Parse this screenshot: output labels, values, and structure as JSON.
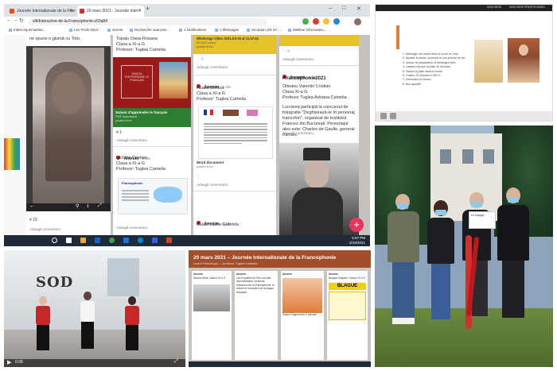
{
  "browser": {
    "tabs": [
      {
        "label": "Journée Internationale de la Fran"
      },
      {
        "label": "20 mars 2021 - Journée Inter"
      }
    ],
    "new_tab": "+",
    "window_controls": [
      "–",
      "□",
      "✕"
    ],
    "nav": [
      "←",
      "→",
      "↻"
    ],
    "url": "ellt/Interactive-de-la-Francophonie-z03a84"
  },
  "bookmarks": [
    "Interconjorimianito...",
    "Les Profs 2013",
    "semne",
    "Recherche avancée...",
    "1 Notifications",
    "1 Messages",
    "Scorpion (24.10 -...",
    "Meilleur Décoration..."
  ],
  "padlet": {
    "top_caption": "ne spune o glumă cu Toto.",
    "col2": {
      "top_lines": [
        "Topalu Oana-Roxana",
        "Clasa a XI-a G",
        "Profesor: Tuglea Camelia"
      ],
      "book_title": "SAISON D'APPRENDRE LE FRANÇAIS",
      "doc_title": "Saison d'apprendre le français",
      "doc_type": "PDF document",
      "doc_src": "padlet drive",
      "likes": "1",
      "comment": "Adaugă comentariu",
      "author": "Anonim",
      "author_time": "3 zile",
      "lines": [
        "Nichifor Cristian",
        "Clasa a XI-a G",
        "Profesor: Tuglea Camelia"
      ],
      "map_title": "Francophonie",
      "comment2": "Adaugă comentariu"
    },
    "col3": {
      "video_title": "WhatsApp Video 2021-03-19 at 11.47.51",
      "video_meta": "00:00:4 video",
      "video_src": "padlet drive",
      "likes": "0",
      "comment": "Adaugă comentariu",
      "author": "Anonim",
      "author_time": "3 zile",
      "lines": [
        "Abaza Denisa",
        "Clasa a XI-a G",
        "Profesor: Tuglea Camelia"
      ],
      "word_title": "Word document",
      "word_src": "padlet drive",
      "comment2": "Adaugă comentariu",
      "author2": "Anonim",
      "author2_time": "3 zile",
      "lines2": "Balaci Laura-Gabriela"
    },
    "col4": {
      "likes": "0",
      "comment": "Adaugă comentariu",
      "author": "Anonim",
      "author_time": "3 zile",
      "hashtag": "#francophonie2021",
      "lines": [
        "Olteanu Valentin Cristian",
        "Clasa XI-a G",
        "Profesor Tuglea Adriana Camelia"
      ],
      "body": "Lucrarea participă la concursul de fotografie \"Deghizează-te în personaj francofon\", organizat de Institutul Francez din București. Personajul ales este: Charles de Gaulle, general francez.",
      "comment2": "Adaugă comentariu",
      "author2": "Anonim"
    },
    "col1": {
      "likes": "15",
      "comment": "Adaugă comentariu"
    },
    "fab": "+"
  },
  "taskbar": {
    "time": "5:57 PM",
    "date": "3/19/2021"
  },
  "slides": {
    "topbar": [
      "DESCHIDE",
      "DESCHIDE PREZENTAREA"
    ],
    "steps": [
      "1. Mélangez les oeufs avec le sucre et l'eau.",
      "2. Ajoutez la farine, la levure et une pincée de sel.",
      "3. Versez la préparation et mélangez bien.",
      "4. Laissez reposer la pâte 20 minutes.",
      "5. Versez la pâte dans le moule.",
      "6. Cuisez 20 minutes à 180°C.",
      "7. Démoulez et servez.",
      "8. Bon appétit!"
    ]
  },
  "video": {
    "logo": "SOD",
    "time": "0:38"
  },
  "event_page": {
    "title": "20 mars 2021 – Journée Internationale de la Francophonie",
    "subtitle": "Liceul Tehnologic — profesor Tuglea Camelia",
    "cards": [
      {
        "head": "Anonim",
        "text": "Stanciu Alina, clasa a XI-a G"
      },
      {
        "head": "Anonim",
        "text": "Les Enquêtes de Toto sont des documentaires, plusieurs émissions sur la Francophonie, la culture et la tradition de la langue française."
      },
      {
        "head": "Anonim",
        "text": "Saison d'apprendre le français"
      },
      {
        "head": "Anonim",
        "text": "Neagoe Mugdan, Clasa a XI-a G"
      }
    ],
    "blague": "BLAGUE"
  },
  "photo": {
    "sign": "Le voyage..."
  }
}
